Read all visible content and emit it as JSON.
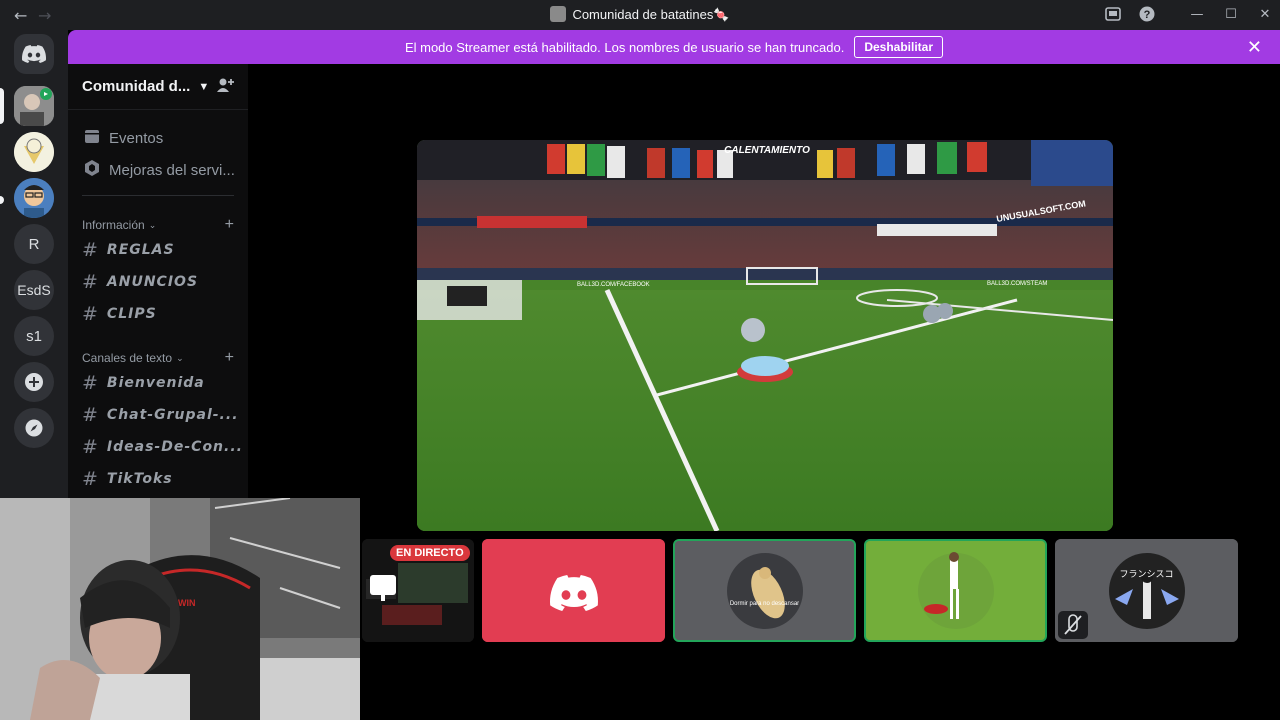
{
  "titlebar": {
    "title": "Comunidad de batatines🍬",
    "back_icon": "arrow-left-icon",
    "forward_icon": "arrow-right-icon"
  },
  "banner": {
    "text": "El modo Streamer está habilitado. Los nombres de usuario se han truncado.",
    "button_label": "Deshabilitar",
    "color": "#a23be3"
  },
  "guilds": {
    "items": [
      "R",
      "EsdS",
      "s1"
    ]
  },
  "server": {
    "name": "Comunidad d...",
    "top_items": [
      "Eventos",
      "Mejoras del servi..."
    ],
    "categories": [
      {
        "name": "Información",
        "channels": [
          "REGLAS",
          "ANUNCIOS",
          "CLIPS"
        ]
      },
      {
        "name": "Canales de texto",
        "channels": [
          "Bienvenida",
          "Chat-Grupal-...",
          "Ideas-De-Con...",
          "TikToks"
        ]
      }
    ]
  },
  "stream": {
    "scoreboard_text": "CALENTAMIENTO",
    "ad_text": "UNUSUALSOFT.COM",
    "ad_text_2": "BALL3D.COM/FACEBOOK",
    "ad_text_3": "BALL3D.COM/STEAM"
  },
  "participants": {
    "live_badge": "EN DIRECTO",
    "tile2_caption": "Dormir para no descansar",
    "tile4_name": "フランシスコ"
  },
  "webcam": {
    "chair_text": "WIN"
  }
}
